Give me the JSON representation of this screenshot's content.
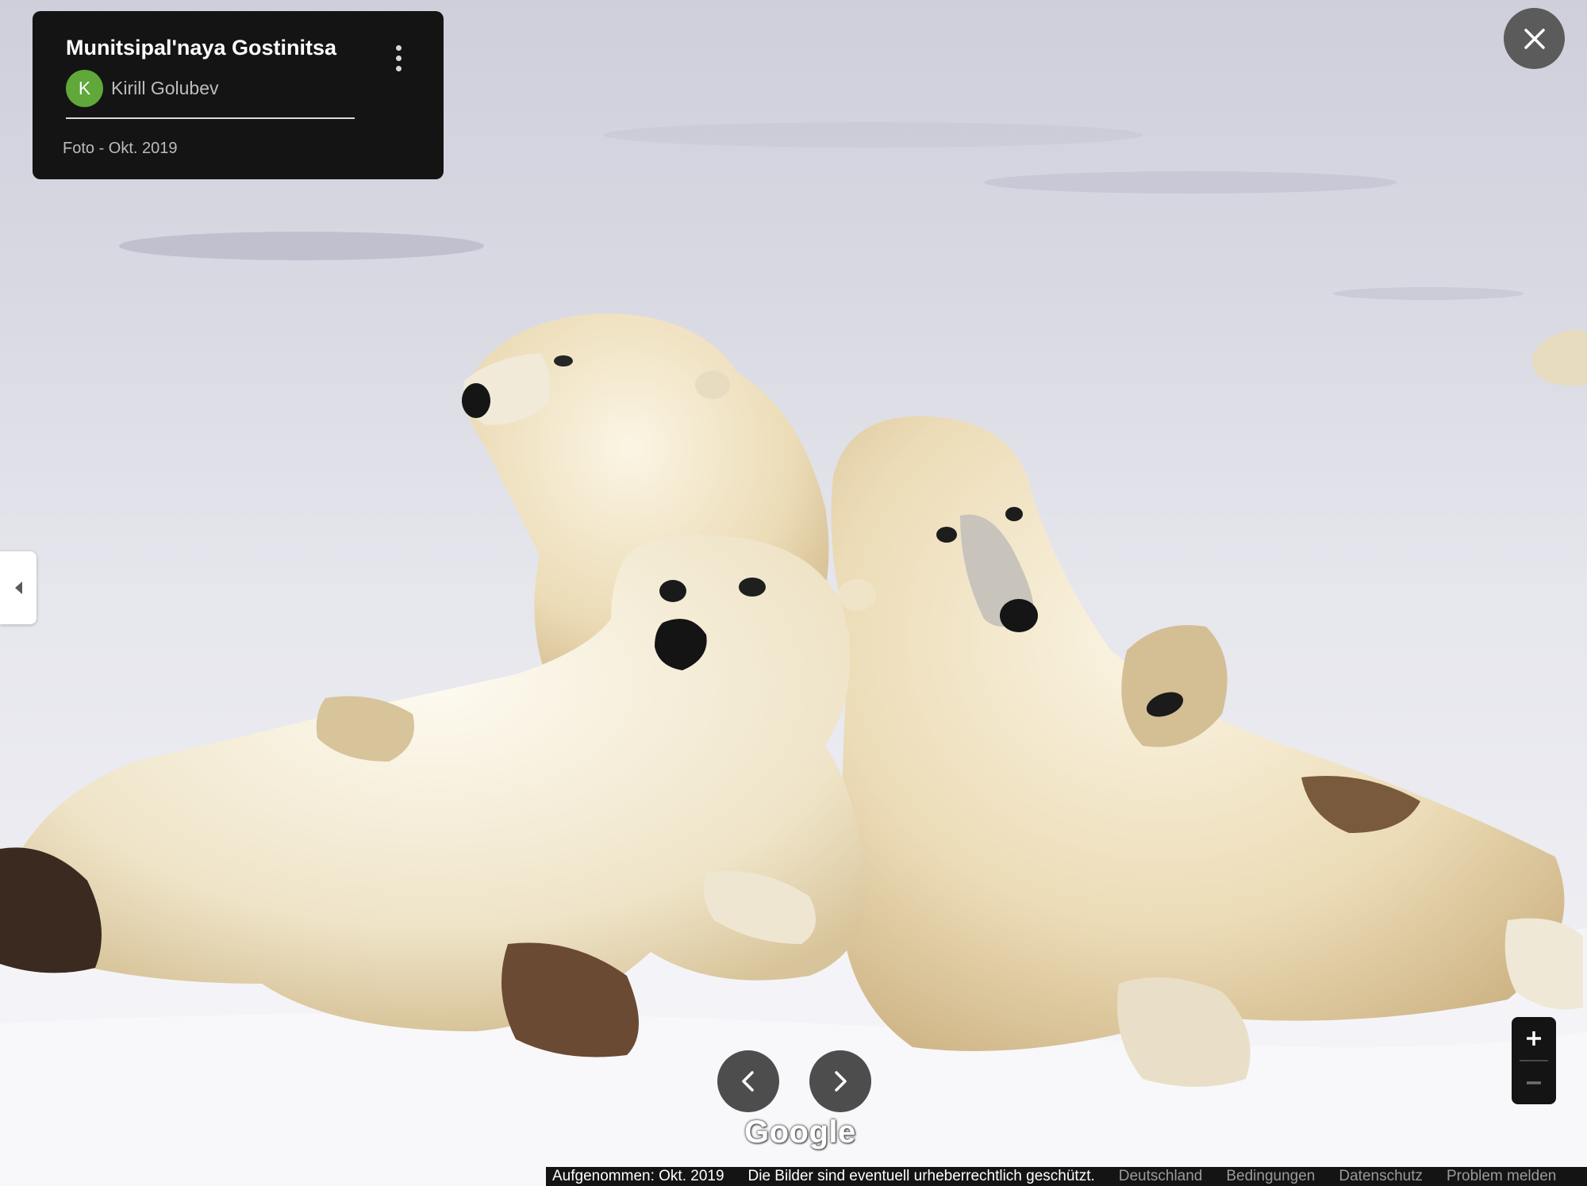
{
  "place": {
    "title": "Munitsipal'naya Gostinitsa",
    "author_initial": "K",
    "author_name": "Kirill Golubev",
    "photo_date": "Foto - Okt. 2019"
  },
  "icons": {
    "more": "more-vertical-icon",
    "close": "close-icon",
    "collapse": "chevron-left-icon",
    "prev": "chevron-left-icon",
    "next": "chevron-right-icon",
    "zoom_in": "plus-icon",
    "zoom_out": "minus-icon"
  },
  "brand": {
    "logo_text": "Google"
  },
  "footer": {
    "captured": "Aufgenommen: Okt. 2019",
    "copyright": "Die Bilder sind eventuell urheberrechtlich geschützt.",
    "country": "Deutschland",
    "terms": "Bedingungen",
    "privacy": "Datenschutz",
    "report": "Problem melden"
  },
  "colors": {
    "panel": "#141414",
    "avatar": "#5fa839",
    "button": "#4d4d4d",
    "snow": "#ececf2"
  }
}
